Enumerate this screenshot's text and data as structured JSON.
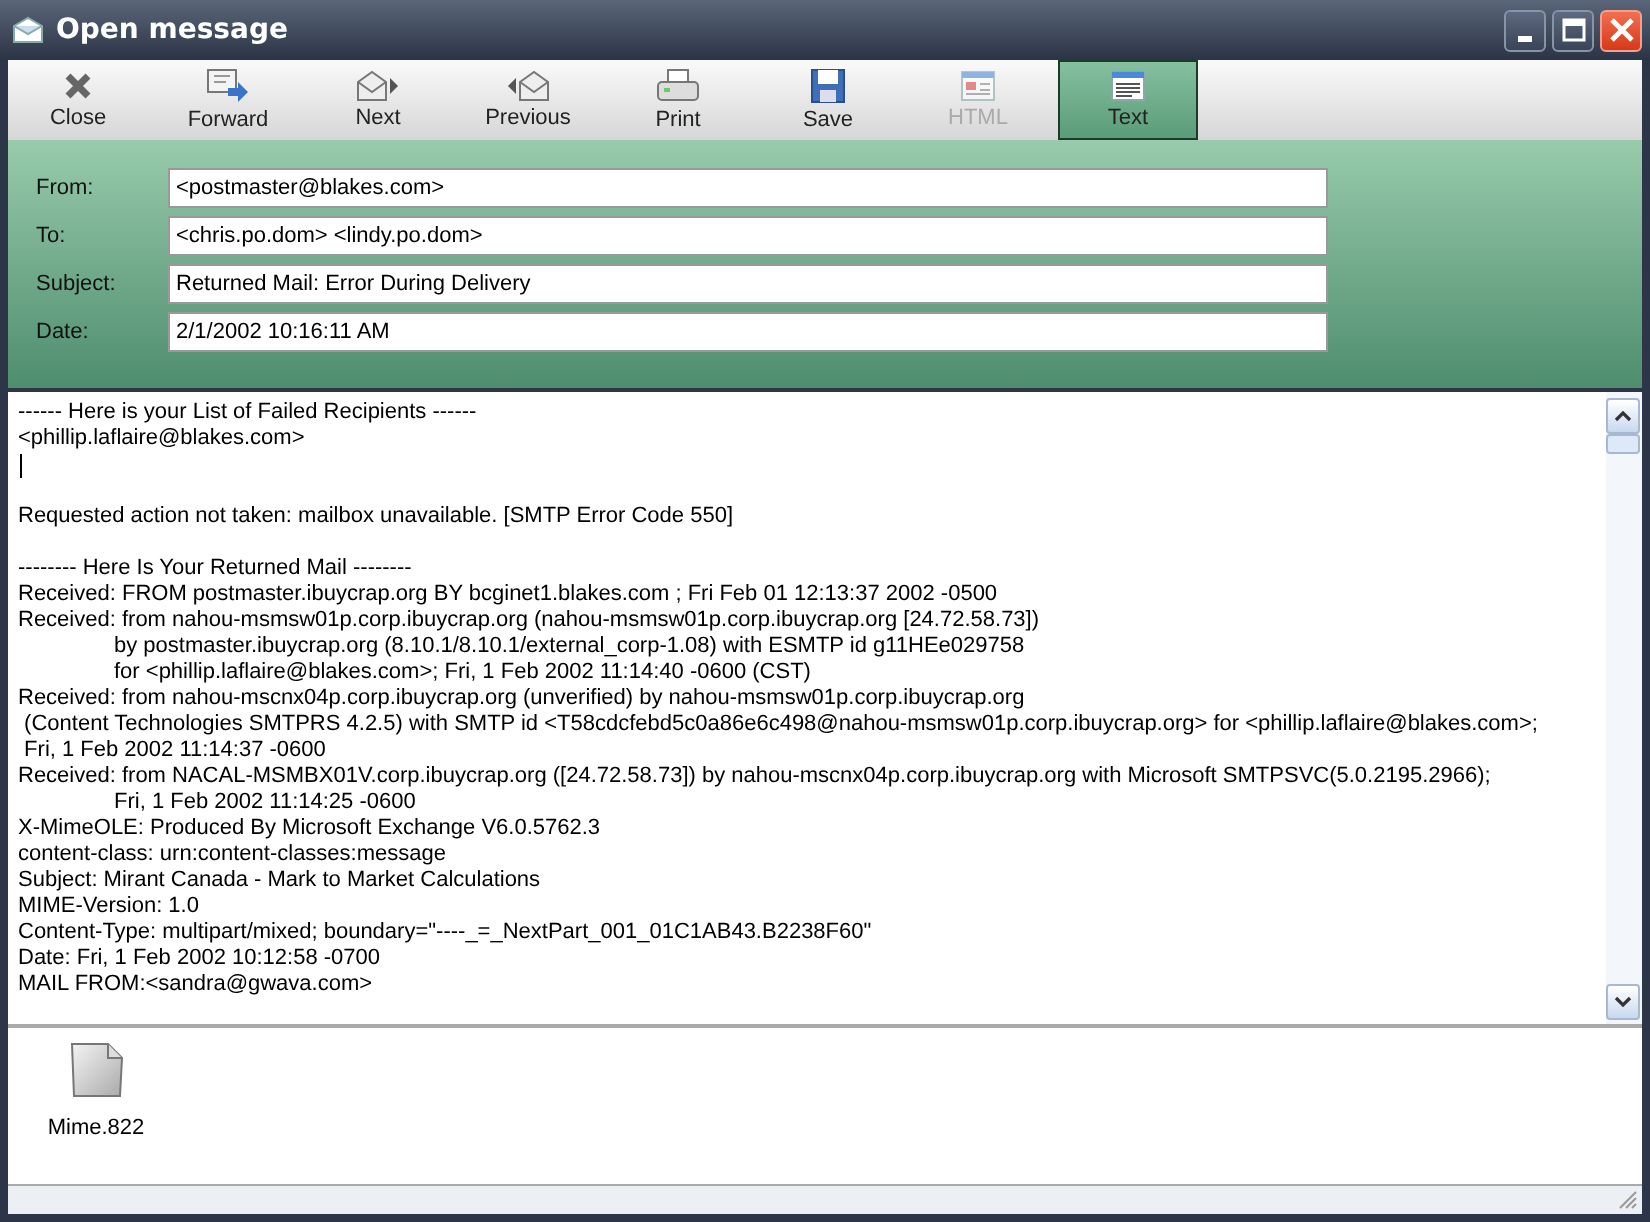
{
  "window": {
    "title": "Open message"
  },
  "toolbar": [
    {
      "kind": "close",
      "label": "Close",
      "selected": false,
      "disabled": false
    },
    {
      "kind": "forward",
      "label": "Forward",
      "selected": false,
      "disabled": false
    },
    {
      "kind": "next",
      "label": "Next",
      "selected": false,
      "disabled": false
    },
    {
      "kind": "previous",
      "label": "Previous",
      "selected": false,
      "disabled": false
    },
    {
      "kind": "print",
      "label": "Print",
      "selected": false,
      "disabled": false
    },
    {
      "kind": "save",
      "label": "Save",
      "selected": false,
      "disabled": false
    },
    {
      "kind": "html",
      "label": "HTML",
      "selected": false,
      "disabled": true
    },
    {
      "kind": "text",
      "label": "Text",
      "selected": true,
      "disabled": false
    }
  ],
  "header_fields": [
    {
      "label": "From:",
      "value": "<postmaster@blakes.com>"
    },
    {
      "label": "To:",
      "value": "<chris.po.dom> <lindy.po.dom>"
    },
    {
      "label": "Subject:",
      "value": "Returned Mail: Error During Delivery"
    },
    {
      "label": "Date:",
      "value": "2/1/2002 10:16:11 AM"
    }
  ],
  "body": {
    "caret": true,
    "blocks": [
      [
        {
          "text": "------ Here is your List of Failed Recipients ------",
          "indented": false
        },
        {
          "text": "<phillip.laflaire@blakes.com>",
          "indented": false
        }
      ],
      [
        {
          "text": "Requested action not taken: mailbox unavailable. [SMTP Error Code 550]",
          "indented": false
        }
      ],
      [
        {
          "text": "-------- Here Is Your Returned Mail --------",
          "indented": false
        },
        {
          "text": "Received: FROM postmaster.ibuycrap.org BY bcginet1.blakes.com ; Fri Feb 01 12:13:37 2002 -0500",
          "indented": false
        },
        {
          "text": "Received: from nahou-msmsw01p.corp.ibuycrap.org (nahou-msmsw01p.corp.ibuycrap.org [24.72.58.73])",
          "indented": false
        },
        {
          "text": "by postmaster.ibuycrap.org (8.10.1/8.10.1/external_corp-1.08) with ESMTP id g11HEe029758",
          "indented": true
        },
        {
          "text": "for <phillip.laflaire@blakes.com>; Fri, 1 Feb 2002 11:14:40 -0600 (CST)",
          "indented": true
        },
        {
          "text": "Received: from nahou-mscnx04p.corp.ibuycrap.org (unverified) by nahou-msmsw01p.corp.ibuycrap.org",
          "indented": false
        },
        {
          "text": " (Content Technologies SMTPRS 4.2.5) with SMTP id <T58cdcfebd5c0a86e6c498@nahou-msmsw01p.corp.ibuycrap.org> for <phillip.laflaire@blakes.com>;",
          "indented": false
        },
        {
          "text": " Fri, 1 Feb 2002 11:14:37 -0600",
          "indented": false
        },
        {
          "text": "Received: from NACAL-MSMBX01V.corp.ibuycrap.org ([24.72.58.73]) by nahou-mscnx04p.corp.ibuycrap.org with Microsoft SMTPSVC(5.0.2195.2966);",
          "indented": false
        },
        {
          "text": "Fri, 1 Feb 2002 11:14:25 -0600",
          "indented": true
        },
        {
          "text": "X-MimeOLE: Produced By Microsoft Exchange V6.0.5762.3",
          "indented": false
        },
        {
          "text": "content-class: urn:content-classes:message",
          "indented": false
        },
        {
          "text": "Subject: Mirant Canada - Mark to Market Calculations",
          "indented": false
        },
        {
          "text": "MIME-Version: 1.0",
          "indented": false
        },
        {
          "text": "Content-Type: multipart/mixed; boundary=\"----_=_NextPart_001_01C1AB43.B2238F60\"",
          "indented": false
        },
        {
          "text": "Date: Fri, 1 Feb 2002 10:12:58 -0700",
          "indented": false
        },
        {
          "text": "MAIL FROM:<sandra@gwava.com>",
          "indented": false
        }
      ]
    ]
  },
  "attachments": [
    {
      "name": "Mime.822"
    }
  ]
}
